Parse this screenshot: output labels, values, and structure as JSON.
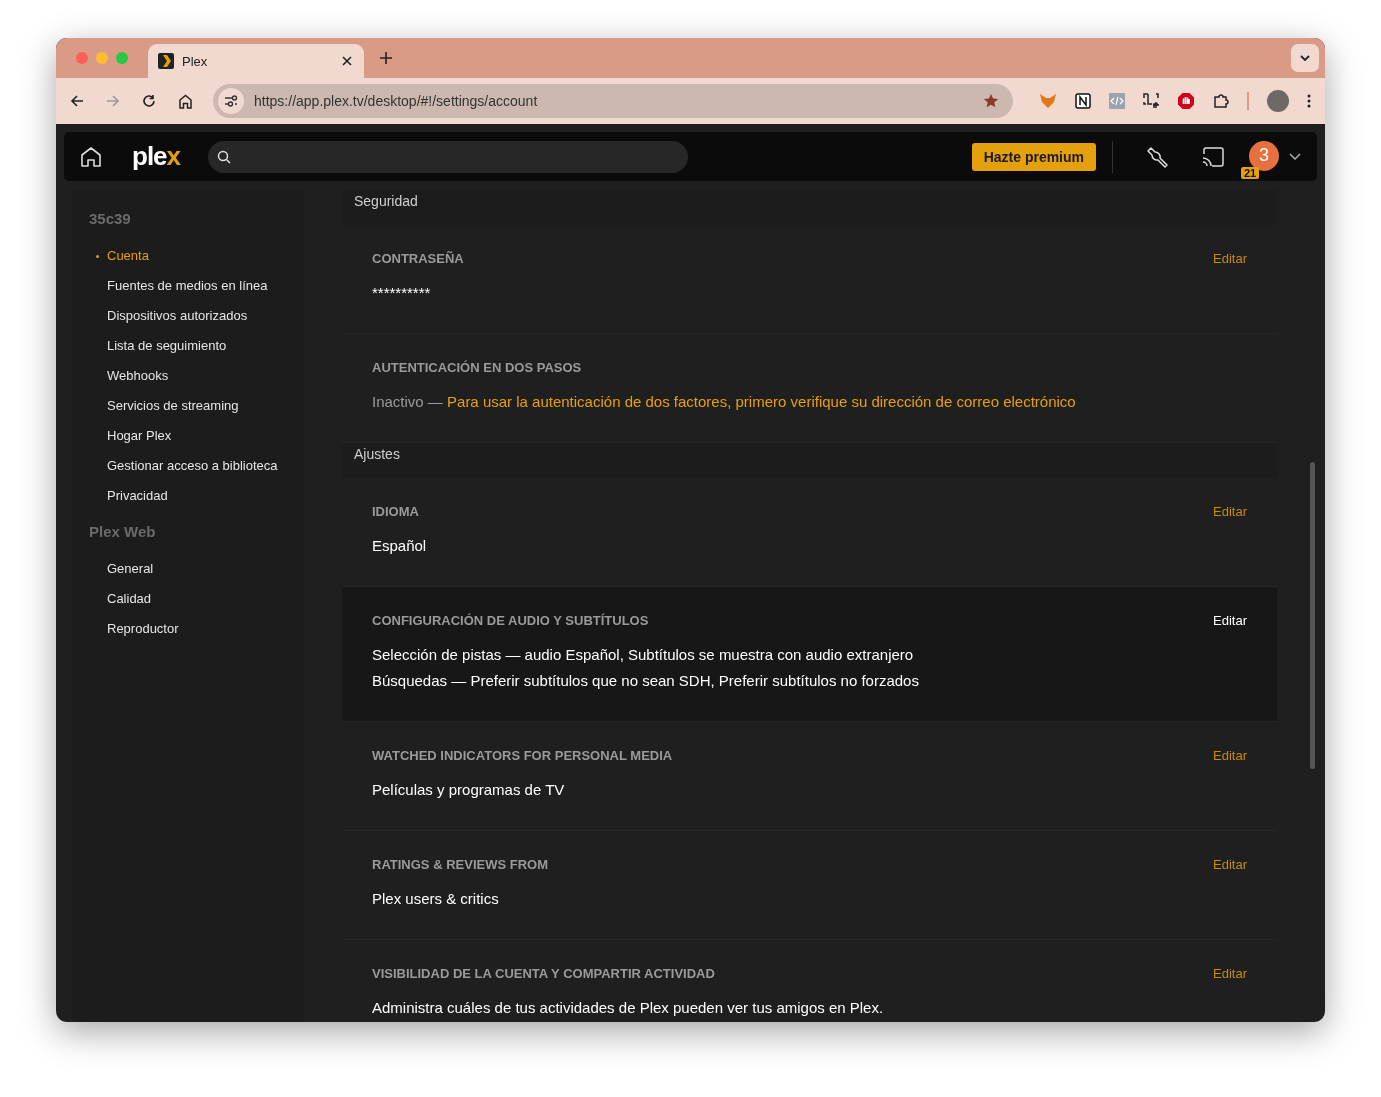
{
  "browser": {
    "tab_title": "Plex",
    "url": "https://app.plex.tv/desktop/#!/settings/account"
  },
  "topbar": {
    "logo_main": "ple",
    "logo_accent": "x",
    "premium_button": "Hazte premium",
    "avatar_count": "3",
    "avatar_badge": "21"
  },
  "sidebar": {
    "sections": [
      {
        "title": "35c39",
        "items": [
          {
            "label": "Cuenta",
            "selected": true
          },
          {
            "label": "Fuentes de medios en línea",
            "selected": false
          },
          {
            "label": "Dispositivos autorizados",
            "selected": false
          },
          {
            "label": "Lista de seguimiento",
            "selected": false
          },
          {
            "label": "Webhooks",
            "selected": false
          },
          {
            "label": "Servicios de streaming",
            "selected": false
          },
          {
            "label": "Hogar Plex",
            "selected": false
          },
          {
            "label": "Gestionar acceso a biblioteca",
            "selected": false
          },
          {
            "label": "Privacidad",
            "selected": false
          }
        ]
      },
      {
        "title": "Plex Web",
        "items": [
          {
            "label": "General",
            "selected": false
          },
          {
            "label": "Calidad",
            "selected": false
          },
          {
            "label": "Reproductor",
            "selected": false
          }
        ]
      }
    ]
  },
  "groups": [
    {
      "title": "Seguridad",
      "settings": [
        {
          "title": "CONTRASEÑA",
          "edit": "Editar",
          "highlighted": false,
          "lines": [
            {
              "text": "**********"
            }
          ]
        },
        {
          "title": "AUTENTICACIÓN EN DOS PASOS",
          "highlighted": false,
          "lines": [
            {
              "status": "Inactivo — ",
              "link": "Para usar la autenticación de dos factores, primero verifique su dirección de correo electrónico"
            }
          ]
        }
      ]
    },
    {
      "title": "Ajustes",
      "settings": [
        {
          "title": "IDIOMA",
          "edit": "Editar",
          "highlighted": false,
          "lines": [
            {
              "text": "Español"
            }
          ]
        },
        {
          "title": "CONFIGURACIÓN DE AUDIO Y SUBTÍTULOS",
          "edit": "Editar",
          "highlighted": true,
          "lines": [
            {
              "text": "Selección de pistas  —  audio Español, Subtítulos se muestra con audio extranjero"
            },
            {
              "text": "Búsquedas  —  Preferir subtítulos que no sean SDH, Preferir subtítulos no forzados"
            }
          ]
        },
        {
          "title": "WATCHED INDICATORS FOR PERSONAL MEDIA",
          "edit": "Editar",
          "highlighted": false,
          "lines": [
            {
              "text": "Películas y programas de TV"
            }
          ]
        },
        {
          "title": "RATINGS & REVIEWS FROM",
          "edit": "Editar",
          "highlighted": false,
          "lines": [
            {
              "text": "Plex users & critics"
            }
          ]
        },
        {
          "title": "VISIBILIDAD DE LA CUENTA Y COMPARTIR ACTIVIDAD",
          "edit": "Editar",
          "highlighted": false,
          "lines": [
            {
              "text": "Administra cuáles de tus actividades de Plex pueden ver tus amigos en Plex."
            }
          ]
        }
      ]
    }
  ]
}
